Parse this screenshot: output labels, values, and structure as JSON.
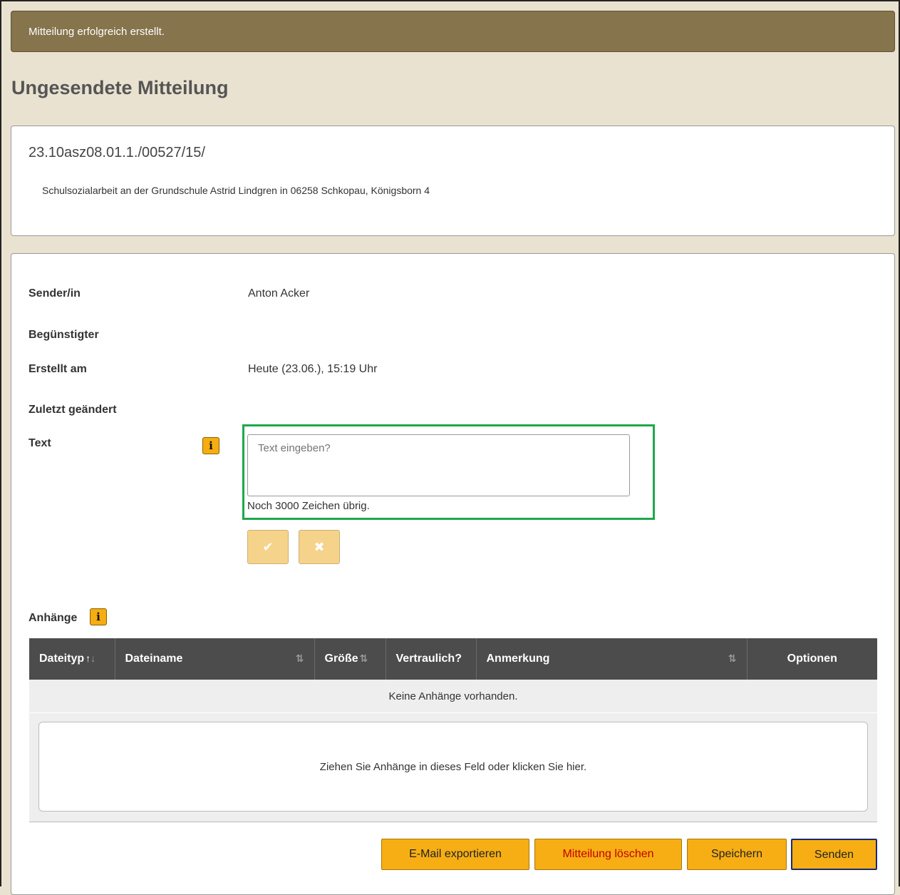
{
  "alert": {
    "message": "Mitteilung erfolgreich erstellt."
  },
  "page_title": "Ungesendete Mitteilung",
  "reference": {
    "number": "23.10asz08.01.1./00527/15/",
    "description": "Schulsozialarbeit an der Grundschule Astrid Lindgren in 06258 Schkopau, Königsborn 4"
  },
  "fields": {
    "sender_label": "Sender/in",
    "sender_value": "Anton Acker",
    "beneficiary_label": "Begünstigter",
    "created_label": "Erstellt am",
    "created_value": "Heute (23.06.), 15:19 Uhr",
    "modified_label": "Zuletzt geändert",
    "text_label": "Text",
    "text_placeholder": "Text eingeben?",
    "char_counter": "Noch 3000 Zeichen übrig."
  },
  "icons": {
    "info": "i",
    "confirm": "✔",
    "cancel": "✖",
    "sort_up": "↑",
    "sort_down": "↓",
    "sort_both": "⇅"
  },
  "attachments": {
    "label": "Anhänge",
    "columns": [
      "Dateityp",
      "Dateiname",
      "Größe",
      "Vertraulich?",
      "Anmerkung",
      "Optionen"
    ],
    "empty_text": "Keine Anhänge vorhanden.",
    "dropzone_text": "Ziehen Sie Anhänge in dieses Feld oder klicken Sie hier."
  },
  "actions": {
    "export": "E-Mail exportieren",
    "delete": "Mitteilung löschen",
    "save": "Speichern",
    "send": "Senden"
  },
  "colors": {
    "alert_bg": "#85744c",
    "accent": "#f6ae14",
    "focus_outline": "#1ea84b",
    "table_header": "#4c4c4c",
    "danger_text": "#c40000",
    "page_bg": "#e9e2d0"
  }
}
